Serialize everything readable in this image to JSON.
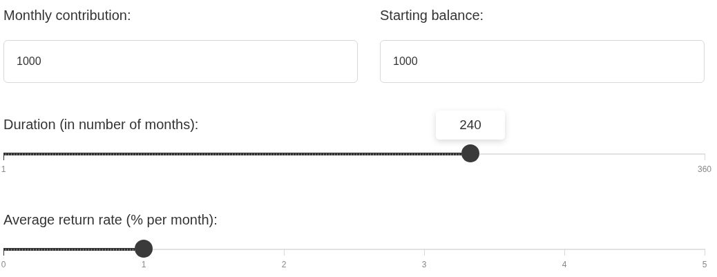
{
  "fields": [
    {
      "label": "Monthly contribution:",
      "value": "1000"
    },
    {
      "label": "Starting balance:",
      "value": "1000"
    }
  ],
  "sliders": [
    {
      "label": "Duration (in number of months):",
      "level": 0.666,
      "tooltip": "240",
      "ticks": [
        "1",
        "360"
      ]
    },
    {
      "label": "Average return rate (% per month):",
      "level": 0.2,
      "ticks": [
        "0",
        "1",
        "2",
        "3",
        "4",
        "5"
      ]
    }
  ]
}
